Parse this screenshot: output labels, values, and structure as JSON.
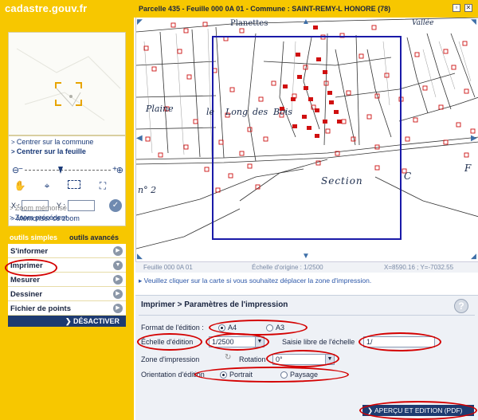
{
  "header": {
    "logo": "cadastre.gouv.fr",
    "title": "Parcelle 435 - Feuille 000 0A 01 - Commune : SAINT-REMY-L HONORE (78)"
  },
  "navigation": {
    "center_commune": "Centrer sur la commune",
    "center_sheet": "Centrer sur la feuille",
    "coord_x_label": "X :",
    "coord_y_label": "Y :",
    "memorize_zoom": "Mémoriser ce zoom",
    "zoom_memorized": "Zoom mémorisé",
    "zoom_previous": "Zoom précédent"
  },
  "tools": {
    "tab_simple": "outils simples",
    "tab_advanced": "outils avancés",
    "items": [
      "S'informer",
      "Imprimer",
      "Mesurer",
      "Dessiner",
      "Fichier de points"
    ],
    "deactivate": "DÉSACTIVER"
  },
  "map": {
    "labels": {
      "planettes": "Planettes",
      "vallee": "Vallée",
      "plaine": "Plaine",
      "le": "le",
      "long": "Long",
      "des": "des",
      "bois": "Bois",
      "section": "Section",
      "c": "C",
      "f": "F",
      "n2": "n° 2"
    },
    "footer_sheet": "Feuille 000 0A 01",
    "footer_scale": "Échelle d'origine : 1/2500",
    "footer_coords": "X=8590.16 ; Y=-7032.55",
    "hint": "Veuillez cliquer sur la carte si vous souhaitez déplacer la zone d'impression."
  },
  "print": {
    "title": "Imprimer > Paramètres de l'impression",
    "format_label": "Format de l'édition :",
    "format_a4": "A4",
    "format_a3": "A3",
    "format_selected": "A4",
    "scale_label": "Échelle d'édition",
    "scale_value": "1/2500",
    "free_scale_label": "Saisie libre de l'échelle",
    "free_scale_value": "1/",
    "zone_label": "Zone d'impression",
    "rotation_label": "Rotation",
    "rotation_value": "0°",
    "orientation_label": "Orientation d'édition",
    "orientation_portrait": "Portrait",
    "orientation_landscape": "Paysage",
    "orientation_selected": "Portrait",
    "preview_button": "APERÇU ET EDITION (PDF)"
  },
  "colors": {
    "brand_yellow": "#f7c700",
    "navy": "#1e3b70",
    "annotation_red": "#d40000",
    "print_frame": "#1a1aa8",
    "parcel_red": "#cc1111"
  }
}
